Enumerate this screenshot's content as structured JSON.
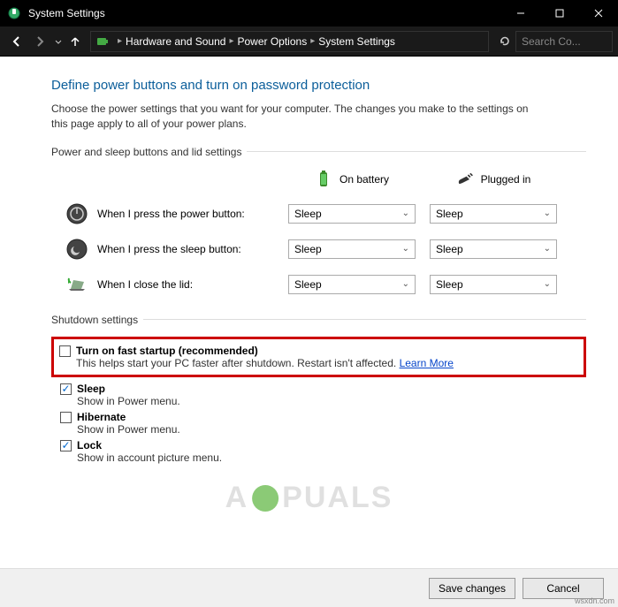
{
  "window": {
    "title": "System Settings"
  },
  "breadcrumb": {
    "items": [
      "Hardware and Sound",
      "Power Options",
      "System Settings"
    ]
  },
  "search": {
    "placeholder": "Search Co..."
  },
  "page": {
    "title": "Define power buttons and turn on password protection",
    "description": "Choose the power settings that you want for your computer. The changes you make to the settings on this page apply to all of your power plans."
  },
  "section1": {
    "head": "Power and sleep buttons and lid settings",
    "col_battery": "On battery",
    "col_plugged": "Plugged in",
    "rows": [
      {
        "label": "When I press the power button:",
        "battery": "Sleep",
        "plugged": "Sleep"
      },
      {
        "label": "When I press the sleep button:",
        "battery": "Sleep",
        "plugged": "Sleep"
      },
      {
        "label": "When I close the lid:",
        "battery": "Sleep",
        "plugged": "Sleep"
      }
    ]
  },
  "section2": {
    "head": "Shutdown settings",
    "fast_startup": {
      "label": "Turn on fast startup (recommended)",
      "sub": "This helps start your PC faster after shutdown. Restart isn't affected.",
      "link": "Learn More"
    },
    "sleep": {
      "label": "Sleep",
      "sub": "Show in Power menu."
    },
    "hibernate": {
      "label": "Hibernate",
      "sub": "Show in Power menu."
    },
    "lock": {
      "label": "Lock",
      "sub": "Show in account picture menu."
    }
  },
  "footer": {
    "save": "Save changes",
    "cancel": "Cancel"
  },
  "watermark": {
    "left": "A",
    "right": "PUALS",
    "attrib": "wsxdn.com"
  }
}
